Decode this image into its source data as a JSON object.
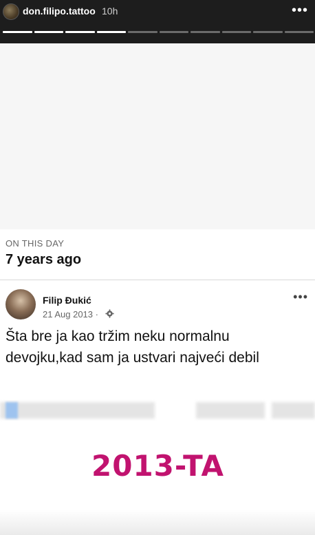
{
  "story": {
    "username": "don.filipo.tattoo",
    "time_ago": "10h",
    "progress_segments": 10,
    "progress_filled": 4
  },
  "memory": {
    "label": "ON THIS DAY",
    "ago": "7 years ago"
  },
  "post": {
    "author": "Filip Đukić",
    "date": "21 Aug 2013 ·",
    "text": "Šta bre ja kao tržim neku normalnu devojku,kad sam ja ustvari najveći debil"
  },
  "footer": {
    "brand_text": "2013-TA",
    "brand_color": "#c1136f"
  }
}
